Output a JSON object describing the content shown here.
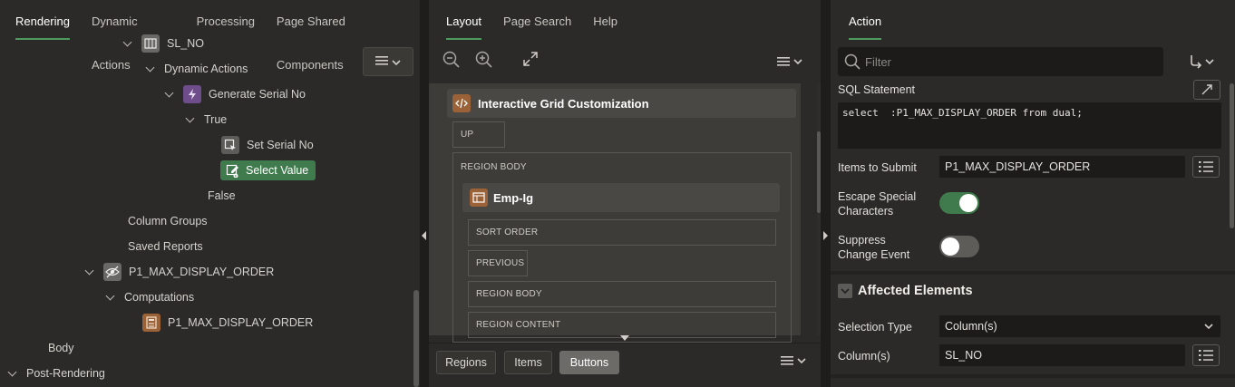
{
  "left": {
    "tabs": [
      "Rendering",
      "Dynamic Actions",
      "Processing",
      "Page Shared Components"
    ],
    "tree": {
      "sl_no": "SL_NO",
      "dynamic_actions": "Dynamic Actions",
      "generate_serial_no": "Generate Serial No",
      "true_label": "True",
      "set_serial_no": "Set Serial No",
      "select_value": "Select Value",
      "false_label": "False",
      "column_groups": "Column Groups",
      "saved_reports": "Saved Reports",
      "p1_max_display_order": "P1_MAX_DISPLAY_ORDER",
      "computations": "Computations",
      "computation_item": "P1_MAX_DISPLAY_ORDER",
      "body": "Body",
      "post_rendering": "Post-Rendering"
    }
  },
  "mid": {
    "tabs": [
      "Layout",
      "Page Search",
      "Help"
    ],
    "canvas": {
      "region_title": "Interactive Grid Customization",
      "up": "UP",
      "region_body": "REGION BODY",
      "emp_title": "Emp-Ig",
      "sort_order": "SORT ORDER",
      "previous": "PREVIOUS",
      "region_body_2": "REGION BODY",
      "region_content": "REGION CONTENT"
    },
    "bottom": {
      "regions": "Regions",
      "items": "Items",
      "buttons": "Buttons"
    }
  },
  "right": {
    "tab": "Action",
    "filter_placeholder": "Filter",
    "sql_statement_label": "SQL Statement",
    "sql_statement_value": "select  :P1_MAX_DISPLAY_ORDER from dual;",
    "items_to_submit_label": "Items to Submit",
    "items_to_submit_value": "P1_MAX_DISPLAY_ORDER",
    "escape_special_label": "Escape Special Characters",
    "escape_special_on": true,
    "suppress_change_label": "Suppress Change Event",
    "suppress_change_on": false,
    "affected_elements_heading": "Affected Elements",
    "selection_type_label": "Selection Type",
    "selection_type_value": "Column(s)",
    "columns_label": "Column(s)",
    "columns_value": "SL_NO"
  },
  "colors": {
    "accent_green": "#3f7b4d",
    "toggle_on": "#3f7b4d",
    "toggle_off": "#5e5c58",
    "background": "#2b2a28"
  }
}
